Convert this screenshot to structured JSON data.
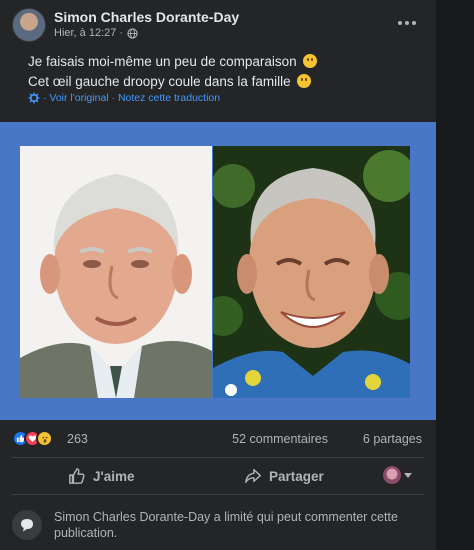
{
  "post": {
    "author": "Simon Charles Dorante-Day",
    "timestamp": "Hier, à 12:27 ·",
    "audience_icon": "globe-icon",
    "more_icon": "more-horizontal-icon",
    "text_line1": "Je faisais moi-même un peu de comparaison",
    "text_line2": "Cet œil gauche droopy coule dans la famille",
    "emoji1": "thinking-face-emoji",
    "emoji2": "smiling-face-emoji",
    "see_original": "· Voir l'original · Notez cette traduction"
  },
  "media": {
    "background": "#4a76c8",
    "photo_left": "older man with white hair in suit",
    "photo_right": "grey-haired man smiling in floral shirt"
  },
  "stats": {
    "reaction_icons": [
      "like-reaction-icon",
      "love-reaction-icon",
      "wow-reaction-icon"
    ],
    "reaction_count": "263",
    "comments": "52 commentaires",
    "shares": "6 partages"
  },
  "actions": {
    "like_label": "J'aime",
    "share_label": "Partager"
  },
  "restriction": {
    "text": "Simon Charles Dorante-Day a limité qui peut commenter cette publication."
  },
  "colors": {
    "background": "#242526",
    "text_primary": "#e4e6eb",
    "text_secondary": "#b0b3b8",
    "link": "#4599ff",
    "like_blue": "#1877f2"
  }
}
